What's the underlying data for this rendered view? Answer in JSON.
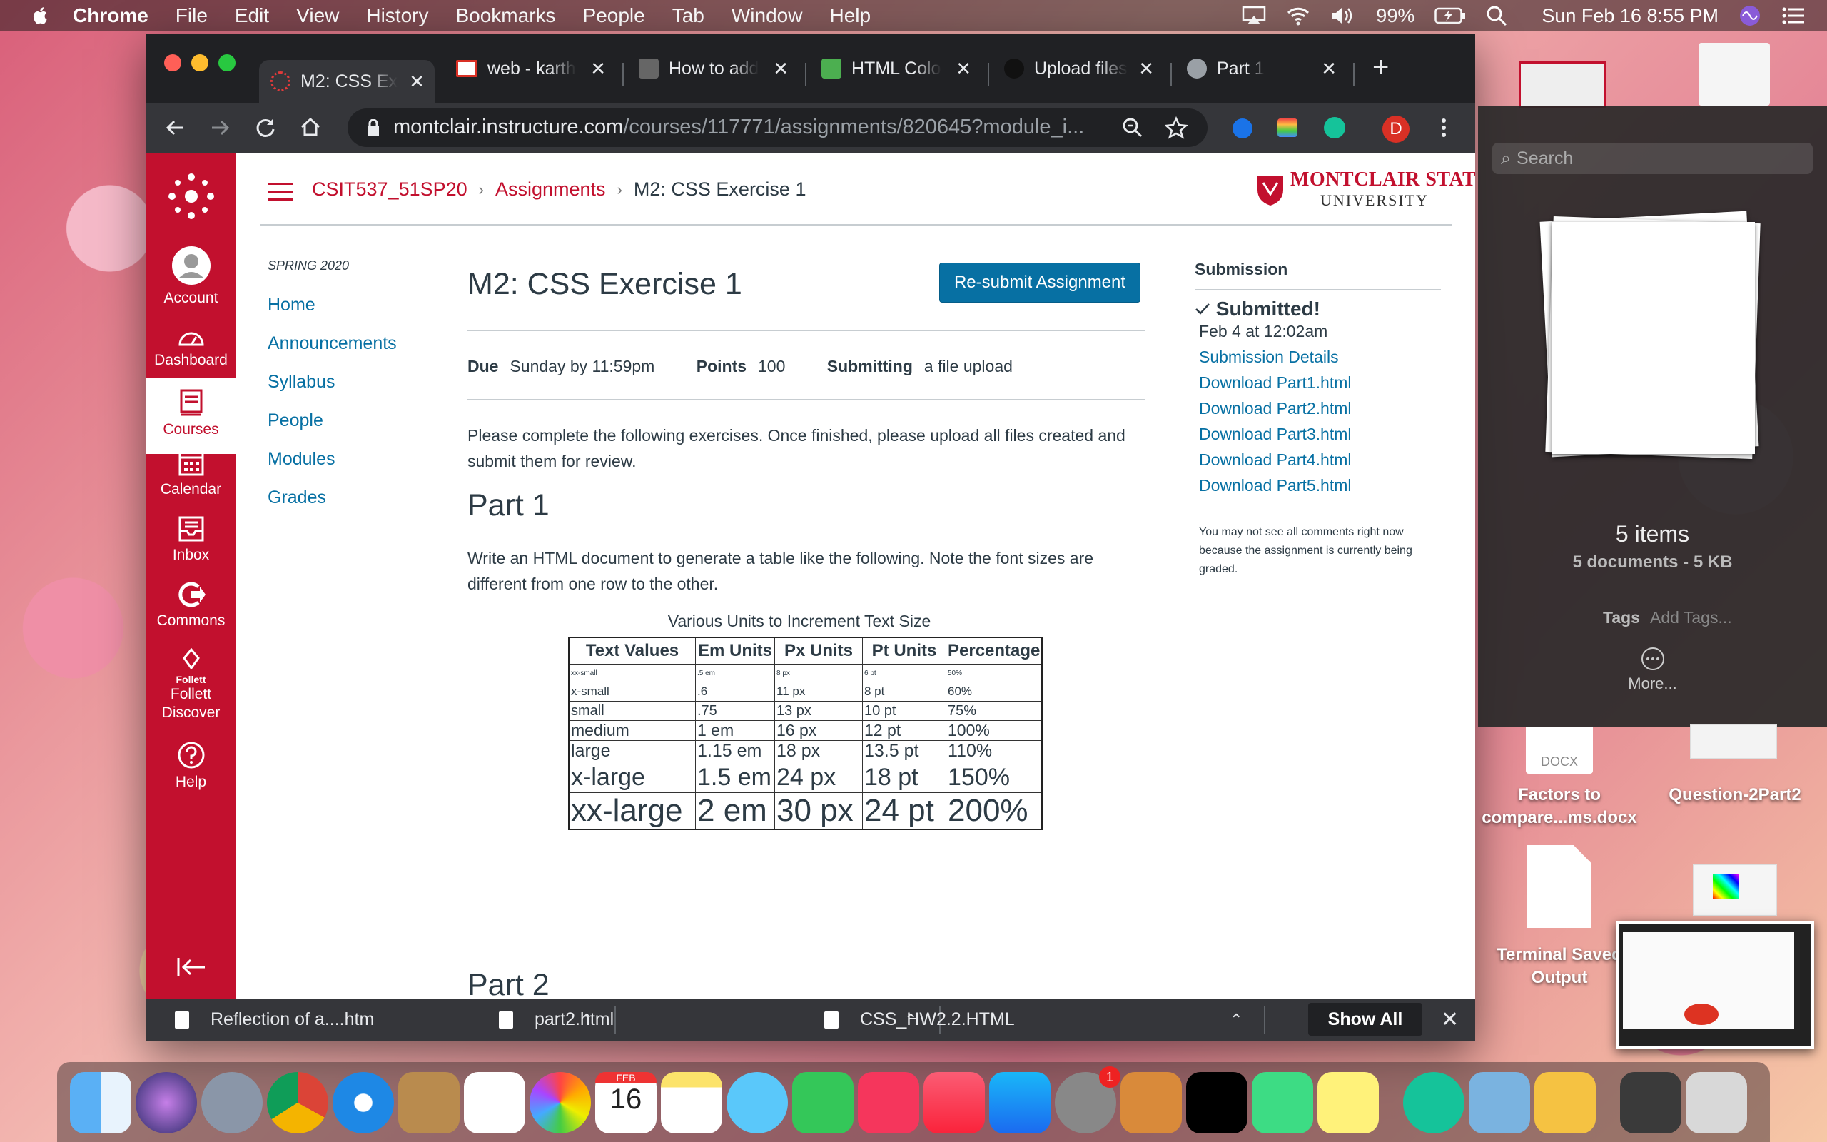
{
  "menubar": {
    "app": "Chrome",
    "items": [
      "File",
      "Edit",
      "View",
      "History",
      "Bookmarks",
      "People",
      "Tab",
      "Window",
      "Help"
    ],
    "battery": "99%",
    "datetime": "Sun Feb 16  8:55 PM"
  },
  "tabs": [
    {
      "title": "M2: CSS Ex",
      "active": true
    },
    {
      "title": "web - karth"
    },
    {
      "title": "How to add"
    },
    {
      "title": "HTML Colo"
    },
    {
      "title": "Upload files"
    },
    {
      "title": "Part 1"
    }
  ],
  "address": {
    "host": "montclair.instructure.com",
    "path": "/courses/117771/assignments/820645?module_i..."
  },
  "profile_initial": "D",
  "global_nav": [
    {
      "label": "Account",
      "icon": "account-icon"
    },
    {
      "label": "Dashboard",
      "icon": "dashboard-icon"
    },
    {
      "label": "Courses",
      "icon": "courses-icon",
      "active": true
    },
    {
      "label": "Calendar",
      "icon": "calendar-icon"
    },
    {
      "label": "Inbox",
      "icon": "inbox-icon"
    },
    {
      "label": "Commons",
      "icon": "commons-icon"
    },
    {
      "label": "Follett\nDiscover",
      "icon": "follett-icon",
      "sub": "Follett"
    },
    {
      "label": "Help",
      "icon": "help-icon"
    }
  ],
  "breadcrumb": {
    "course": "CSIT537_51SP20",
    "section": "Assignments",
    "current": "M2: CSS Exercise 1"
  },
  "brand": {
    "line1": "MONTCLAIR STATE",
    "line2": "UNIVERSITY",
    "color": "#c2102e"
  },
  "course_nav": {
    "term": "SPRING 2020",
    "links": [
      "Home",
      "Announcements",
      "Syllabus",
      "People",
      "Modules",
      "Grades"
    ]
  },
  "assignment": {
    "title": "M2: CSS Exercise 1",
    "resubmit_label": "Re-submit Assignment",
    "due_label": "Due",
    "due_value": "Sunday by 11:59pm",
    "points_label": "Points",
    "points_value": "100",
    "submitting_label": "Submitting",
    "submitting_value": "a file upload",
    "intro": "Please complete the following exercises. Once finished, please upload all files created and submit them for review.",
    "part1_heading": "Part 1",
    "part1_text": "Write an HTML document to generate a table like the following. Note the font sizes are different from one row to the other.",
    "part2_heading": "Part 2"
  },
  "units_table": {
    "caption": "Various Units to Increment Text Size",
    "headers": [
      "Text Values",
      "Em Units",
      "Px Units",
      "Pt Units",
      "Percentage"
    ],
    "rows": [
      [
        "xx-small",
        ".5 em",
        "8 px",
        "6 pt",
        "50%"
      ],
      [
        "x-small",
        ".6",
        "11 px",
        "8 pt",
        "60%"
      ],
      [
        "small",
        ".75",
        "13 px",
        "10 pt",
        "75%"
      ],
      [
        "medium",
        "1 em",
        "16 px",
        "12 pt",
        "100%"
      ],
      [
        "large",
        "1.15 em",
        "18 px",
        "13.5 pt",
        "110%"
      ],
      [
        "x-large",
        "1.5 em",
        "24 px",
        "18 pt",
        "150%"
      ],
      [
        "xx-large",
        "2 em",
        "30 px",
        "24 pt",
        "200%"
      ]
    ]
  },
  "submission": {
    "heading": "Submission",
    "status": "Submitted!",
    "date": "Feb 4 at 12:02am",
    "details_link": "Submission Details",
    "downloads": [
      "Download Part1.html",
      "Download Part2.html",
      "Download Part3.html",
      "Download Part4.html",
      "Download Part5.html"
    ],
    "note": "You may not see all comments right now because the assignment is currently being graded."
  },
  "downloads_bar": {
    "items": [
      "Reflection of a....htm",
      "part2.html",
      "CSS_HW2.2.HTML"
    ],
    "show_all": "Show All"
  },
  "finder_panel": {
    "search_placeholder": "Search",
    "count": "5 items",
    "summary": "5 documents - 5 KB",
    "tags_label": "Tags",
    "tags_placeholder": "Add Tags...",
    "more": "More..."
  },
  "desktop": {
    "docx_badge": "DOCX",
    "file1": "Factors to\ncompare...ms.docx",
    "file2": "Question-2Part2",
    "file3": "Terminal Saved\nOutput"
  },
  "dock": {
    "calendar_month": "FEB",
    "calendar_day": "16",
    "badge": "1"
  }
}
